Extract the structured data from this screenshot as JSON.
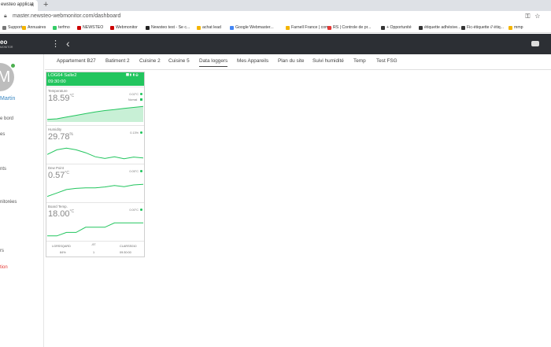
{
  "browser": {
    "tab_title": "ewsteo applicat",
    "url": "master.newsteo-webmonitor.com/dashboard",
    "bookmarks": [
      "Support",
      "Annuaires",
      "terfmo",
      "NEWSTEO",
      "Webmonitor",
      "Newsteo test - Se c...",
      "achat lead",
      "Google Webmaster...",
      "Farnell France | com...",
      "RS | Controle de pr...",
      "+ Opportunité",
      "étiquette adhésive...",
      "Fic-étiquette // étiq...",
      "mmp"
    ]
  },
  "app": {
    "logo": "eo",
    "logo_sub": "MONITOR",
    "user_initial": "M",
    "user_name": "Martin",
    "sidebar": [
      "e bord",
      "es",
      "nts",
      "nitorées",
      "rs",
      "tion"
    ],
    "tabs": [
      "Appartement B27",
      "Batiment 2",
      "Cuisine 2",
      "Cuisine 5",
      "Data loggers",
      "Mes Appareils",
      "Plan du site",
      "Suivi humidité",
      "Temp",
      "Test FSG"
    ],
    "active_tab": "Data loggers"
  },
  "card": {
    "device": "LOG64 Salle2",
    "time": "09:30:00",
    "head_icons": "⯀▮▮⊕",
    "sensors": [
      {
        "label": "Temperature",
        "value": "18.59",
        "unit": "°C",
        "trend": "0.02°C",
        "status": "Normal",
        "series": [
          0.15,
          0.18,
          0.28,
          0.38,
          0.48,
          0.58,
          0.66,
          0.72,
          0.78,
          0.84,
          0.9
        ]
      },
      {
        "label": "Humidity",
        "value": "29.78",
        "unit": "%",
        "trend": "0.13%",
        "series": [
          0.35,
          0.62,
          0.72,
          0.62,
          0.45,
          0.22,
          0.12,
          0.22,
          0.1,
          0.2,
          0.15
        ]
      },
      {
        "label": "Dew Point",
        "value": "0.57",
        "unit": "°C",
        "trend": "0.05°C",
        "series": [
          0.15,
          0.35,
          0.55,
          0.62,
          0.65,
          0.65,
          0.7,
          0.78,
          0.72,
          0.82,
          0.85
        ]
      },
      {
        "label": "Board Temp.",
        "value": "18.00",
        "unit": "°C",
        "trend": "0.00°C",
        "series": [
          0.1,
          0.1,
          0.3,
          0.3,
          0.6,
          0.6,
          0.6,
          0.85,
          0.85,
          0.85,
          0.85
        ]
      }
    ],
    "footer": {
      "left": "LGRSSQARD",
      "mid": "-97",
      "right": "CLARSS010",
      "battery": "84%",
      "signal": "1",
      "check": "09:30:00"
    }
  },
  "colors": {
    "accent": "#22c55e",
    "header": "#2c2f34"
  }
}
